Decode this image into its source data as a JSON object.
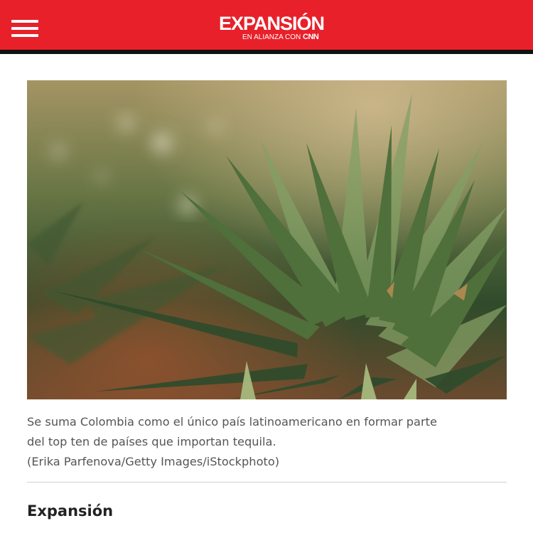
{
  "header": {
    "logo_text": "EXPANSIÓN",
    "logo_subtitle": "EN ALIANZA CON",
    "logo_partner": "CNN",
    "background_color": "#e8202a",
    "menu_icon": "hamburger-menu-icon"
  },
  "article": {
    "caption_line1": "Se suma Colombia como el único país latinoamericano en formar parte",
    "caption_line2": "del top ten de países que importan tequila.",
    "caption_credit": "(Erika Parfenova/Getty Images/iStockphoto)",
    "author": "Expansión"
  }
}
